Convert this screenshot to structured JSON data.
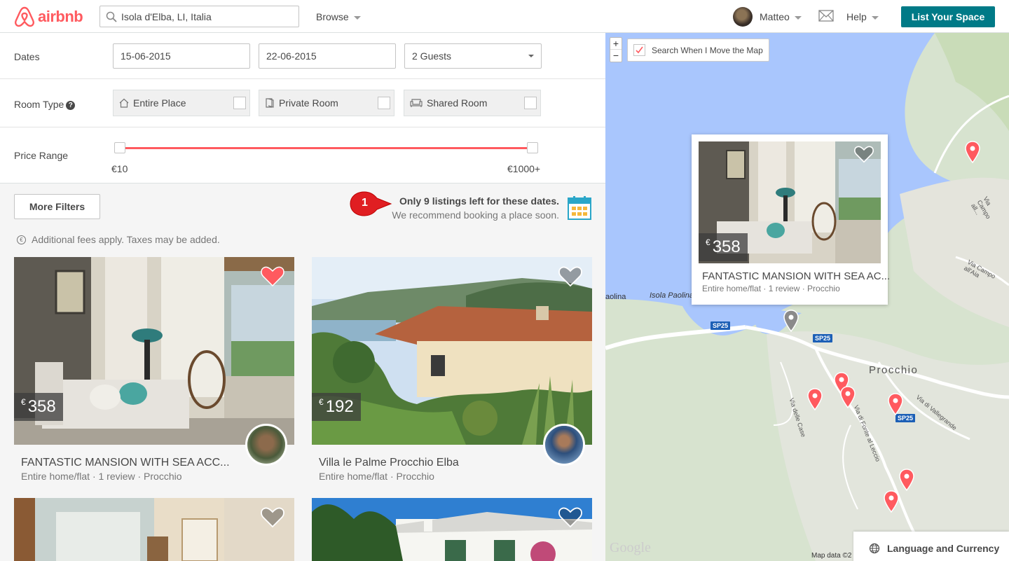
{
  "header": {
    "logo_text": "airbnb",
    "search_value": "Isola d'Elba, LI, Italia",
    "browse_label": "Browse",
    "user_name": "Matteo",
    "help_label": "Help",
    "list_space_label": "List Your Space"
  },
  "filters": {
    "dates_label": "Dates",
    "checkin": "15-06-2015",
    "checkout": "22-06-2015",
    "guests": "2 Guests",
    "room_type_label": "Room Type",
    "room_types": [
      "Entire Place",
      "Private Room",
      "Shared Room"
    ],
    "price_range_label": "Price Range",
    "price_min": "€10",
    "price_max": "€1000+",
    "more_filters_label": "More Filters"
  },
  "urgency": {
    "badge": "1",
    "title": "Only 9 listings left for these dates.",
    "subtitle": "We recommend booking a place soon."
  },
  "fees_note": "Additional fees apply. Taxes may be added.",
  "listings": [
    {
      "currency": "€",
      "price": "358",
      "title": "FANTASTIC MANSION WITH SEA ACC...",
      "subtitle": "Entire home/flat · 1 review · Procchio",
      "favorited": true
    },
    {
      "currency": "€",
      "price": "192",
      "title": "Villa le Palme Procchio Elba",
      "subtitle": "Entire home/flat · Procchio",
      "favorited": false
    }
  ],
  "map": {
    "zoom_in": "+",
    "zoom_out": "−",
    "search_move_label": "Search When I Move the Map",
    "popup": {
      "currency": "€",
      "price": "358",
      "title": "FANTASTIC MANSION WITH SEA AC...",
      "subtitle": "Entire home/flat · 1 review · Procchio"
    },
    "place_labels": [
      "aolina",
      "Isola Paolina",
      "Procchio",
      "Via delle Case",
      "Via di Fonte al Leccio",
      "Via di Vallegrande",
      "Via Campo all'Aia",
      "Via Campo all..."
    ],
    "road_shields": [
      "SP25",
      "SP25",
      "SP25"
    ],
    "attribution": "Map data ©2",
    "google": "Google",
    "language_currency": "Language and Currency"
  },
  "colors": {
    "brand": "#ff5a5f",
    "primary_button": "#007a87",
    "sea": "#a9c6fd",
    "land": "#d9e4cf"
  }
}
